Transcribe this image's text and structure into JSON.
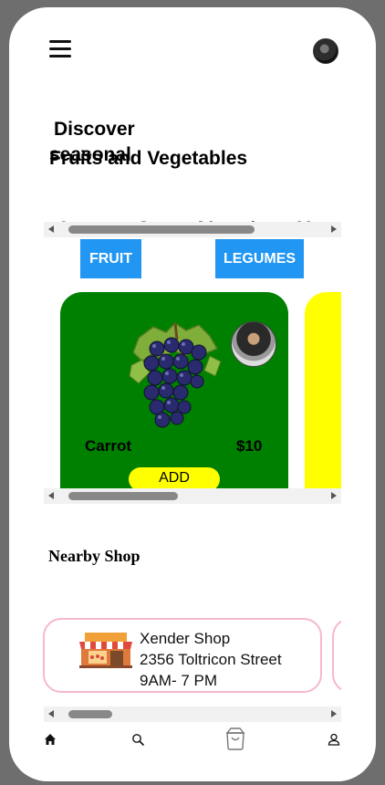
{
  "header": {
    "menu_icon": "hamburger-menu-icon",
    "profile_icon": "user-avatar"
  },
  "hero": {
    "line1": "Discover",
    "line2": "seasonal",
    "line3": "Fruits and Vegetables"
  },
  "fruit_tabs": [
    "Orange",
    "Grapes",
    "Watermelon",
    "Mango"
  ],
  "categories": [
    {
      "label": "FRUIT"
    },
    {
      "label": "LEGUMES"
    }
  ],
  "product": {
    "name": "Carrot",
    "price": "$10",
    "add_label": "ADD",
    "card_color": "#008000",
    "next_card_color": "#ffff00"
  },
  "nearby": {
    "heading": "Nearby Shop",
    "shop": {
      "name": "Xender Shop",
      "address": "2356 Toltricon Street",
      "hours": "9AM- 7 PM"
    }
  },
  "bottom_nav": [
    "home-icon",
    "search-icon",
    "shopping-bag-icon",
    "user-icon"
  ],
  "colors": {
    "accent": "#2196f3",
    "card_border": "#f7b8cb",
    "add_button": "#ffff00"
  }
}
